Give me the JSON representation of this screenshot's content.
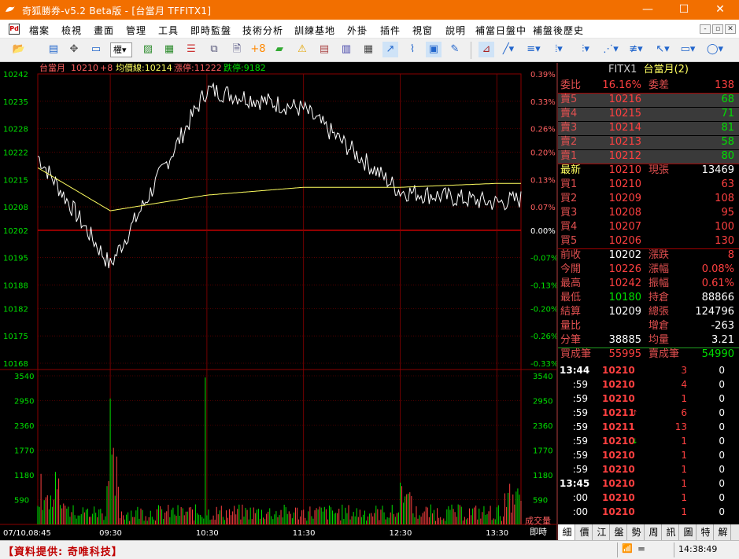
{
  "window": {
    "title": "奇狐勝券-v5.2 Beta版 - [台當月 TFFITX1]",
    "minimize": "—",
    "maximize": "☐",
    "close": "✕"
  },
  "menu": {
    "items": [
      "檔案",
      "檢視",
      "畫面",
      "管理",
      "工具",
      "即時監盤",
      "技術分析",
      "訓練基地",
      "外掛",
      "插件",
      "視窗",
      "說明",
      "補當日盤中",
      "補盤後歷史"
    ]
  },
  "mdi": [
    "-",
    "▫",
    "✕"
  ],
  "toolbar": {
    "dropdown_label": "權▾"
  },
  "chart": {
    "header_name": "台當月",
    "header_price": "10210",
    "header_change": "+8",
    "header_avg": "均價線:10214",
    "header_limit_up": "漲停:11222",
    "header_limit_down": "跌停:9182",
    "price_ticks": [
      "10242",
      "10235",
      "10228",
      "10222",
      "10215",
      "10208",
      "10202",
      "10195",
      "10188",
      "10182",
      "10175",
      "10168"
    ],
    "pct_ticks": [
      "0.39%",
      "0.33%",
      "0.26%",
      "0.20%",
      "0.13%",
      "0.07%",
      "0.00%",
      "-0.07%",
      "-0.13%",
      "-0.20%",
      "-0.26%",
      "-0.33%"
    ],
    "vol_ticks": [
      "3540",
      "2950",
      "2360",
      "1770",
      "1180",
      "590"
    ],
    "time_ticks": [
      "07/10,08:45",
      "09:30",
      "10:30",
      "11:30",
      "12:30",
      "13:30"
    ],
    "vol_label": "成交量",
    "mode_label": "即時"
  },
  "chart_data": {
    "type": "line",
    "x": [
      "08:45",
      "09:30",
      "10:30",
      "11:30",
      "12:30",
      "13:30",
      "13:45"
    ],
    "series": [
      {
        "name": "",
        "values": [
          10221,
          10193,
          10238,
          10233,
          10212,
          10209,
          10210
        ]
      },
      {
        "name": "均價線",
        "values": [
          10218,
          10207,
          10211,
          10213,
          10213,
          10214,
          10214
        ]
      }
    ],
    "ylim": [
      10168,
      10242
    ],
    "vol_ylim": [
      0,
      3540
    ]
  },
  "quote": {
    "symbol": "FITX1",
    "name": "台當月(2)",
    "rows": [
      {
        "lab": "委比",
        "val": "16.16%",
        "lab2": "委差",
        "val2": "138"
      },
      {
        "lab": "賣5",
        "val": "10216",
        "val2": "68"
      },
      {
        "lab": "賣4",
        "val": "10215",
        "val2": "71"
      },
      {
        "lab": "賣3",
        "val": "10214",
        "val2": "81"
      },
      {
        "lab": "賣2",
        "val": "10213",
        "val2": "58"
      },
      {
        "lab": "賣1",
        "val": "10212",
        "val2": "80"
      },
      {
        "lab": "最新",
        "val": "10210",
        "lab2": "現張",
        "val2": "13469"
      },
      {
        "lab": "買1",
        "val": "10210",
        "val2": "63"
      },
      {
        "lab": "買2",
        "val": "10209",
        "val2": "108"
      },
      {
        "lab": "買3",
        "val": "10208",
        "val2": "95"
      },
      {
        "lab": "買4",
        "val": "10207",
        "val2": "100"
      },
      {
        "lab": "買5",
        "val": "10206",
        "val2": "130"
      },
      {
        "lab": "前收",
        "val": "10202",
        "lab2": "漲跌",
        "val2": "8"
      },
      {
        "lab": "今開",
        "val": "10226",
        "lab2": "漲幅",
        "val2": "0.08%"
      },
      {
        "lab": "最高",
        "val": "10242",
        "lab2": "振幅",
        "val2": "0.61%"
      },
      {
        "lab": "最低",
        "val": "10180",
        "lab2": "持倉",
        "val2": "88866"
      },
      {
        "lab": "結算",
        "val": "10209",
        "lab2": "總張",
        "val2": "124796"
      },
      {
        "lab": "量比",
        "val": "",
        "lab2": "增倉",
        "val2": "-263"
      },
      {
        "lab": "分筆",
        "val": "38885",
        "lab2": "均量",
        "val2": "3.21"
      },
      {
        "lab": "買成筆",
        "val": "55995",
        "lab2": "賣成筆",
        "val2": "54990"
      }
    ],
    "ticks": [
      {
        "tm": "13:44",
        "px": "10210",
        "vol": "3",
        "chg": "0"
      },
      {
        "tm": ":59",
        "px": "10210",
        "vol": "4",
        "chg": "0"
      },
      {
        "tm": ":59",
        "px": "10210",
        "vol": "1",
        "chg": "0"
      },
      {
        "tm": ":59",
        "px": "10211",
        "vol": "6",
        "chg": "0",
        "arrow": "↑"
      },
      {
        "tm": ":59",
        "px": "10211",
        "vol": "13",
        "chg": "0"
      },
      {
        "tm": ":59",
        "px": "10210",
        "vol": "1",
        "chg": "0",
        "arrow": "↓"
      },
      {
        "tm": ":59",
        "px": "10210",
        "vol": "1",
        "chg": "0"
      },
      {
        "tm": ":59",
        "px": "10210",
        "vol": "1",
        "chg": "0"
      },
      {
        "tm": "13:45",
        "px": "10210",
        "vol": "1",
        "chg": "0"
      },
      {
        "tm": ":00",
        "px": "10210",
        "vol": "1",
        "chg": "0"
      },
      {
        "tm": ":00",
        "px": "10210",
        "vol": "1",
        "chg": "0"
      }
    ],
    "tabs": [
      "細",
      "價",
      "江",
      "盤",
      "勢",
      "周",
      "訊",
      "圖",
      "特",
      "解"
    ]
  },
  "status": {
    "provider": "【資料提供: 奇唯科技】",
    "clock": "14:38:49",
    "sep": "="
  },
  "colors": {
    "up": "#ff4040",
    "down": "#00e000",
    "grid": "#8b0000",
    "avg": "#ffff60",
    "price": "#ffffff",
    "title": "#f26f00"
  }
}
